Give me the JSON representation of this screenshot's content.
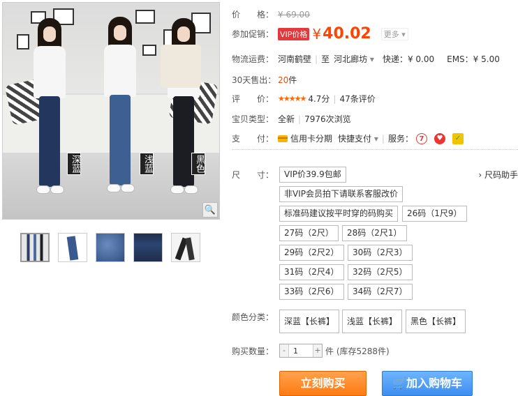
{
  "gallery": {
    "color_tags": [
      "深蓝",
      "浅蓝",
      "黑色"
    ],
    "zoom_icon": "magnifier-icon",
    "thumbnail_count": 5
  },
  "price": {
    "label": "价　　格：",
    "original": "¥ 69.00"
  },
  "promo": {
    "label": "参加促销：",
    "badge": "VIP价格",
    "currency": "¥",
    "value": "40.02",
    "more": "更多 ▾"
  },
  "shipping": {
    "label": "物流运费：",
    "from": "河南鹤壁",
    "to_prefix": "至",
    "to": "河北廊坊",
    "express": "快递：¥ 0.00",
    "ems": "EMS：¥ 5.00"
  },
  "sold": {
    "label": "30天售出：",
    "count": "20",
    "unit": "件"
  },
  "rating": {
    "label": "评　　价：",
    "stars": "★★★★★",
    "score": "4.7分",
    "reviews": "47条评价"
  },
  "type": {
    "label": "宝贝类型：",
    "value": "全新",
    "views": "7976次浏览"
  },
  "payment": {
    "label": "支　　付：",
    "credit": "信用卡分期",
    "quick": "快捷支付",
    "service_label": "服务："
  },
  "size": {
    "label": "尺　　寸：",
    "help": "› 尺码助手",
    "options": [
      "VIP价39.9包邮",
      "非VIP会员拍下请联系客服改价",
      "标准码建议按平时穿的码购买",
      "26码（1尺9）",
      "27码（2尺）",
      "28码（2尺1）",
      "29码（2尺2）",
      "30码（2尺3）",
      "31码（2尺4）",
      "32码（2尺5）",
      "33码（2尺6）",
      "34码（2尺7）"
    ]
  },
  "color": {
    "label": "颜色分类：",
    "options": [
      "深蓝【长裤】",
      "浅蓝【长裤】",
      "黑色【长裤】"
    ]
  },
  "quantity": {
    "label": "购买数量：",
    "value": "1",
    "minus": "-",
    "plus": "+",
    "stock": "件 (库存5288件)"
  },
  "actions": {
    "buy": "立刻购买",
    "cart": "加入购物车"
  },
  "colors": {
    "accent": "#ff4400",
    "buy_button": "#ff8a1f",
    "cart_button": "#4a98f5"
  }
}
